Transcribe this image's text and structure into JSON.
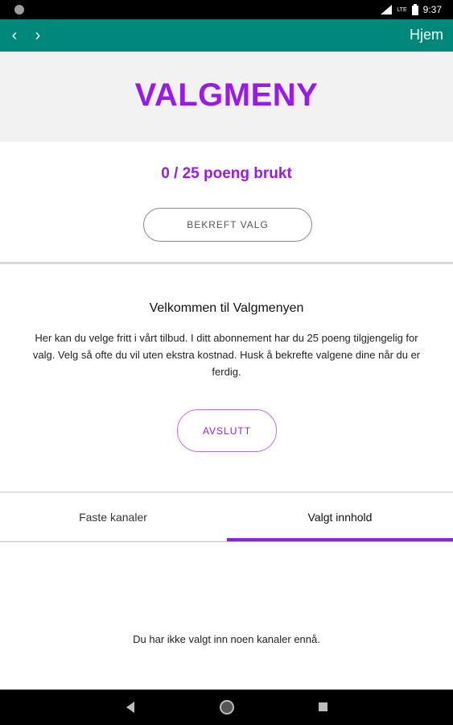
{
  "status_bar": {
    "time": "9:37",
    "network_label": "LTE",
    "left_icon": "notification-dot-icon",
    "right_icons": [
      "signal-icon",
      "battery-icon"
    ]
  },
  "app_bar": {
    "title": "Hjem",
    "back_icon": "‹",
    "forward_icon": "›",
    "color": "#00897b"
  },
  "header": {
    "title": "VALGMENY",
    "accent_color": "#9a1be5"
  },
  "points": {
    "text": "0 / 25 poeng brukt"
  },
  "buttons": {
    "confirm_label": "BEKREFT VALG",
    "exit_label": "AVSLUTT"
  },
  "welcome": {
    "title": "Velkommen til Valgmenyen",
    "body": "Her kan du velge fritt i vårt tilbud. I ditt abonnement har du 25 poeng tilgjengelig for valg. Velg så ofte du vil uten ekstra kostnad. Husk å bekrefte valgene dine når du er ferdig."
  },
  "tabs": [
    {
      "label": "Faste kanaler",
      "selected": false
    },
    {
      "label": "Valgt innhold",
      "selected": true
    }
  ],
  "empty_state": {
    "message": "Du har ikke valgt inn noen kanaler ennå."
  },
  "system_nav": {
    "icons": [
      "back-triangle-icon",
      "home-circle-icon",
      "recents-square-icon"
    ]
  }
}
